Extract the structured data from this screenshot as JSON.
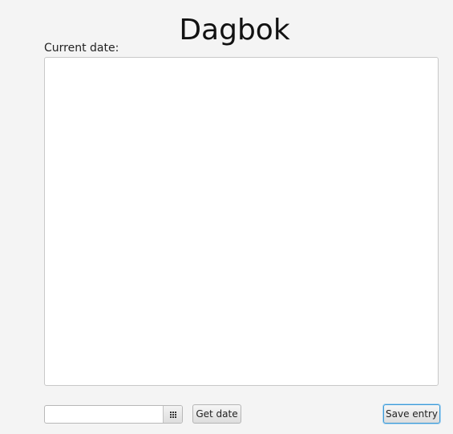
{
  "app": {
    "title": "Dagbok"
  },
  "entry": {
    "date_label": "Current date:",
    "text": ""
  },
  "footer": {
    "date_value": "",
    "get_date_label": "Get date",
    "save_label": "Save entry"
  },
  "icons": {
    "calendar": "calendar-icon"
  },
  "colors": {
    "background": "#f4f4f4",
    "focus_border": "#3c9ad6"
  }
}
